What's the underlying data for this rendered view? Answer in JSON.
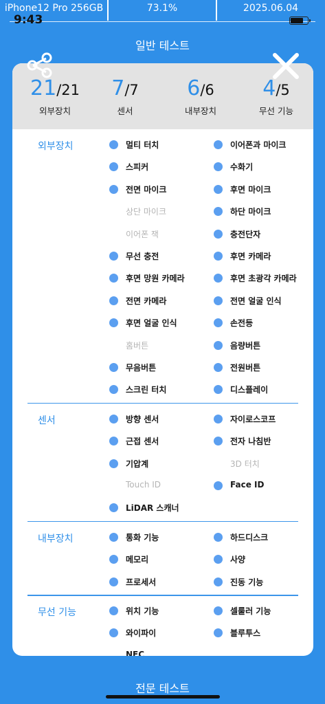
{
  "status": {
    "device": "iPhone12 Pro 256GB",
    "battery": "73.1%",
    "date": "2025.06.04",
    "time": "9:43"
  },
  "top_title": "일반 테스트",
  "bottom_title": "전문 테스트",
  "icons": {
    "share": "share-icon",
    "close": "close-icon"
  },
  "colors": {
    "accent": "#2F8FE8",
    "dot": "#5B9FF0",
    "disabled": "#B4B4B4",
    "header_bg": "#E3E3E3"
  },
  "summary": [
    {
      "done": "21",
      "total": "/21",
      "label": "외부장치"
    },
    {
      "done": "7",
      "total": "/7",
      "label": "센서"
    },
    {
      "done": "6",
      "total": "/6",
      "label": "내부장치"
    },
    {
      "done": "4",
      "total": "/5",
      "label": "무선 기능"
    }
  ],
  "sections": [
    {
      "title": "외부장치",
      "items": [
        {
          "label": "멀티 터치",
          "done": true
        },
        {
          "label": "이어폰과 마이크",
          "done": true
        },
        {
          "label": "스피커",
          "done": true
        },
        {
          "label": "수화기",
          "done": true
        },
        {
          "label": "전면 마이크",
          "done": true
        },
        {
          "label": "후면 마이크",
          "done": true
        },
        {
          "label": "상단 마이크",
          "done": false
        },
        {
          "label": "하단 마이크",
          "done": true
        },
        {
          "label": "이어폰 잭",
          "done": false
        },
        {
          "label": "충전단자",
          "done": true
        },
        {
          "label": "무선 충전",
          "done": true
        },
        {
          "label": "후면 카메라",
          "done": true
        },
        {
          "label": "후면 망원 카메라",
          "done": true
        },
        {
          "label": "후면 초광각 카메라",
          "done": true
        },
        {
          "label": "전면 카메라",
          "done": true
        },
        {
          "label": "전면 얼굴 인식",
          "done": true
        },
        {
          "label": "후면 얼굴 인식",
          "done": true
        },
        {
          "label": "손전등",
          "done": true
        },
        {
          "label": "홈버튼",
          "done": false
        },
        {
          "label": "음량버튼",
          "done": true
        },
        {
          "label": "무음버튼",
          "done": true
        },
        {
          "label": "전원버튼",
          "done": true
        },
        {
          "label": "스크린 터치",
          "done": true
        },
        {
          "label": "디스플레이",
          "done": true
        }
      ]
    },
    {
      "title": "센서",
      "items": [
        {
          "label": "방향 센서",
          "done": true
        },
        {
          "label": "자이로스코프",
          "done": true
        },
        {
          "label": "근접 센서",
          "done": true
        },
        {
          "label": "전자 나침반",
          "done": true
        },
        {
          "label": "기압계",
          "done": true
        },
        {
          "label": "3D 터치",
          "done": false
        },
        {
          "label": "Touch ID",
          "done": false
        },
        {
          "label": "Face ID",
          "done": true
        },
        {
          "label": "LiDAR 스캐너",
          "done": true
        }
      ]
    },
    {
      "title": "내부장치",
      "items": [
        {
          "label": "통화 기능",
          "done": true
        },
        {
          "label": "하드디스크",
          "done": true
        },
        {
          "label": "메모리",
          "done": true
        },
        {
          "label": "사양",
          "done": true
        },
        {
          "label": "프로세서",
          "done": true
        },
        {
          "label": "진동 기능",
          "done": true
        }
      ]
    },
    {
      "title": "무선 기능",
      "items": [
        {
          "label": "위치 기능",
          "done": true
        },
        {
          "label": "셀룰러 기능",
          "done": true
        },
        {
          "label": "와이파이",
          "done": true
        },
        {
          "label": "블루투스",
          "done": true
        },
        {
          "label": "NFC",
          "done": false,
          "plain": true
        }
      ]
    }
  ]
}
